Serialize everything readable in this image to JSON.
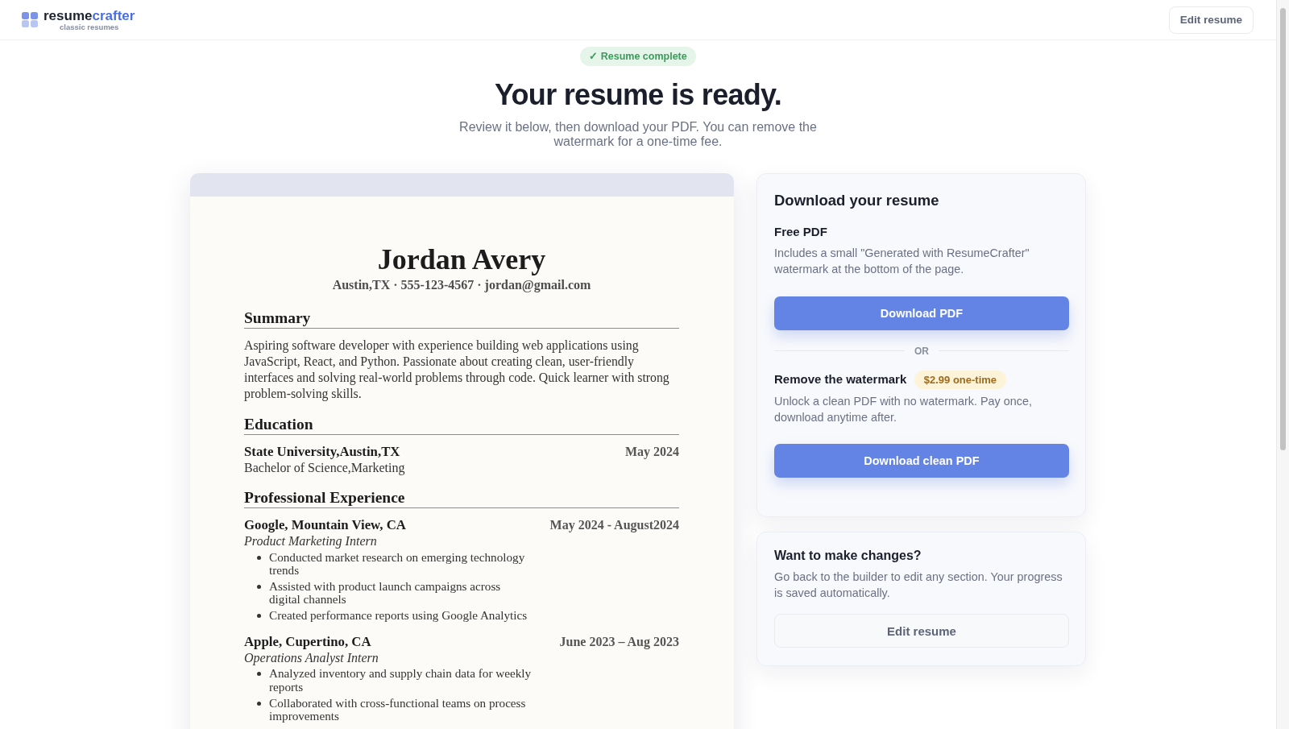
{
  "header": {
    "logo": {
      "prefix": "resume",
      "suffix": "crafter",
      "tagline": "classic resumes"
    },
    "edit_button": "Edit resume"
  },
  "hero": {
    "badge": "✓ Resume complete",
    "title": "Your resume is ready.",
    "subtitle": "Review it below, then download your PDF. You can remove the watermark for a one-time fee."
  },
  "resume": {
    "name": "Jordan Avery",
    "contact": "Austin,TX · 555-123-4567 · jordan@gmail.com",
    "sections": [
      {
        "kind": "paragraph",
        "heading": "Summary",
        "text": "Aspiring software developer with experience building web applications using JavaScript, React, and Python. Passionate about creating clean, user-friendly interfaces and solving real-world problems through code. Quick learner with strong problem-solving skills."
      },
      {
        "kind": "entries",
        "heading": "Education",
        "entries": [
          {
            "title": "State University,Austin,TX",
            "date": "May 2024",
            "degree": "Bachelor of Science,Marketing"
          }
        ]
      },
      {
        "kind": "entries",
        "heading": "Professional Experience",
        "entries": [
          {
            "title": "Google, Mountain View, CA",
            "date": "May 2024 - August2024",
            "role": "Product Marketing Intern",
            "bullets": [
              "Conducted market research on emerging technology trends",
              "Assisted with product launch campaigns across digital channels",
              "Created performance reports using Google Analytics"
            ]
          },
          {
            "title": "Apple, Cupertino, CA",
            "date": "June 2023 – Aug 2023",
            "role": "Operations Analyst Intern",
            "bullets": [
              "Analyzed inventory and supply chain data for weekly reports",
              "Collaborated with cross-functional teams on process improvements"
            ]
          }
        ]
      }
    ]
  },
  "download_panel": {
    "title": "Download your resume",
    "options": [
      {
        "heading": "Free PDF",
        "description": "Includes a small \"Generated with ResumeCrafter\" watermark at the bottom of the page.",
        "button": "Download PDF"
      },
      {
        "heading": "Remove the watermark",
        "price": "$2.99 one-time",
        "description": "Unlock a clean PDF with no watermark. Pay once, download anytime after.",
        "button": "Download clean PDF"
      }
    ],
    "separator": "OR"
  },
  "changes_panel": {
    "title": "Want to make changes?",
    "description": "Go back to the builder to edit any section. Your progress is saved automatically.",
    "button": "Edit resume"
  }
}
